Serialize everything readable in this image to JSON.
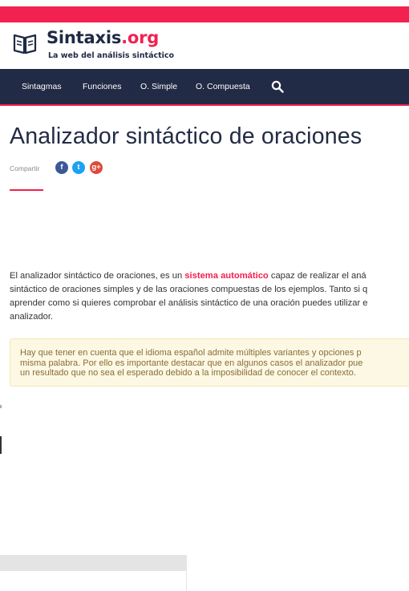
{
  "brand": {
    "name": "Sintaxis",
    "tld": ".org",
    "tagline": "La web del análisis sintáctico",
    "accent_color": "#f2214f",
    "dark_color": "#222b45",
    "logo_icon": "open-book-icon"
  },
  "nav": {
    "items": [
      {
        "label": "Sintagmas"
      },
      {
        "label": "Funciones"
      },
      {
        "label": "O. Simple"
      },
      {
        "label": "O. Compuesta"
      }
    ],
    "search_icon": "search-icon"
  },
  "page": {
    "title": "Analizador sintáctico de oraciones",
    "share_label": "Compartir",
    "share": {
      "facebook": "f",
      "twitter": "t",
      "googleplus": "g+"
    }
  },
  "intro": {
    "line1_pre": "El analizador sintáctico de oraciones, es un ",
    "line1_highlight": "sistema automático",
    "line1_post": " capaz de realizar el aná",
    "line2": "sintáctico de oraciones simples y de las oraciones compuestas de los ejemplos. Tanto si q",
    "line3": "aprender como si quieres comprobar el análisis sintáctico de una oración puedes utilizar e",
    "line4": "analizador."
  },
  "notice": {
    "line1": "Hay que tener en cuenta que el idioma español admite múltiples variantes y opciones p",
    "line2": "misma palabra. Por ello es importante destacar que en algunos casos el analizador pue",
    "line3": "un resultado que no sea el esperado debido a la imposibilidad de conocer el contexto.",
    "bg_color": "#fcf8e3",
    "text_color": "#8a6d3b"
  }
}
